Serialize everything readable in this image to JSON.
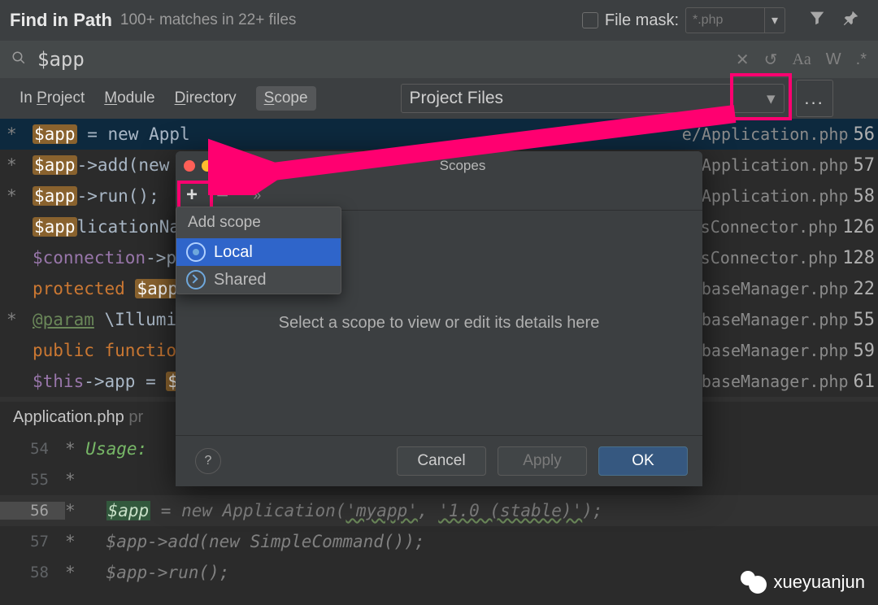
{
  "header": {
    "title": "Find in Path",
    "subtitle": "100+ matches in 22+ files",
    "file_mask_label": "File mask:",
    "file_mask_value": "*.php"
  },
  "search": {
    "query": "$app"
  },
  "tabs": {
    "project": "In Project",
    "module": "Module",
    "directory": "Directory",
    "scope": "Scope"
  },
  "scope_select": "Project Files",
  "dots_label": "...",
  "results": [
    {
      "star": "*",
      "pre_hl": "",
      "hl": "$app",
      "post": " = new Appl",
      "file": "e/Application.php",
      "line": "56",
      "sel": true
    },
    {
      "star": "*",
      "pre_hl": "",
      "hl": "$app",
      "post": "->add(new",
      "file": "e/Application.php",
      "line": "57"
    },
    {
      "star": "*",
      "pre_hl": "",
      "hl": "$app",
      "post": "->run();",
      "file": "e/Application.php",
      "line": "58"
    },
    {
      "star": "",
      "pre_hl": "",
      "hl": "$app",
      "post": "licationName =",
      "file": "sConnector.php",
      "line": "126",
      "half": true
    },
    {
      "star": "",
      "pre": "$connection->prep",
      "file": "sConnector.php",
      "line": "128",
      "plain": true
    },
    {
      "star": "",
      "pre": "protected ",
      "hl": "$app",
      "post": ";",
      "file": "baseManager.php",
      "line": "22",
      "protected": true
    },
    {
      "star": "*",
      "ann": "@param",
      "post2": "\\Illuminat",
      "file": "baseManager.php",
      "line": "55"
    },
    {
      "star": "",
      "pre": "public function __co",
      "file": "baseManager.php",
      "line": "59",
      "pubfn": true
    },
    {
      "star": "",
      "pre": "$this->app = ",
      "hl": "$app",
      "post": ";",
      "file": "baseManager.php",
      "line": "61",
      "thisapp": true
    }
  ],
  "open_file_tab": "Application.php",
  "open_file_hint": "pr",
  "code": [
    {
      "n": "54",
      "star": "*",
      "text": "Usage:"
    },
    {
      "n": "55",
      "star": "*",
      "text": ""
    },
    {
      "n": "56",
      "star": "*",
      "code": true
    },
    {
      "n": "57",
      "star": "*",
      "text": "$app->add(new SimpleCommand());"
    },
    {
      "n": "58",
      "star": "*",
      "text": "$app->run();"
    }
  ],
  "code56": {
    "var": "$app",
    "rest": " = new Application(",
    "s1": "'myapp'",
    "comma": ", ",
    "s2": "'1.0 (stable)'",
    "end": ");"
  },
  "dialog": {
    "title": "Scopes",
    "body": "Select a scope to view or edit its details here",
    "cancel": "Cancel",
    "apply": "Apply",
    "ok": "OK",
    "help": "?"
  },
  "menu": {
    "title": "Add scope",
    "local": "Local",
    "shared": "Shared"
  },
  "watermark": "xueyuanjun"
}
